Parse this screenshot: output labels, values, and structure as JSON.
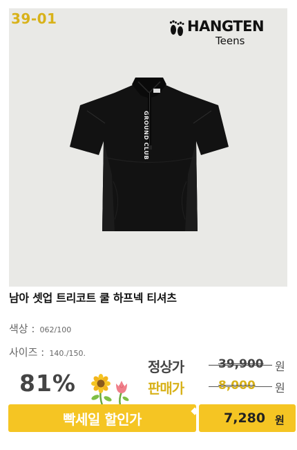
{
  "product": {
    "code": "39-01",
    "brand": "HANGTEN",
    "brand_sub": "Teens",
    "title": "남아 셋업 트리코트 쿨 하프넥 티셔츠",
    "graphic_text": "GROUND CLUB"
  },
  "options": {
    "color_label": "색상 :",
    "color_value": "062/100",
    "size_label": "사이즈 :",
    "size_value": "140./150."
  },
  "pricing": {
    "regular_label": "정상가",
    "regular_price": "39,900",
    "sale_label": "판매가",
    "sale_price": "8,000",
    "currency": "원",
    "discount": "81%",
    "event_label": "빡세일 할인가",
    "final_price": "7,280",
    "final_currency": "원"
  },
  "colors": {
    "accent_yellow": "#f5c523",
    "code_gold": "#d8b21a",
    "photo_bg": "#e9e9e6"
  }
}
